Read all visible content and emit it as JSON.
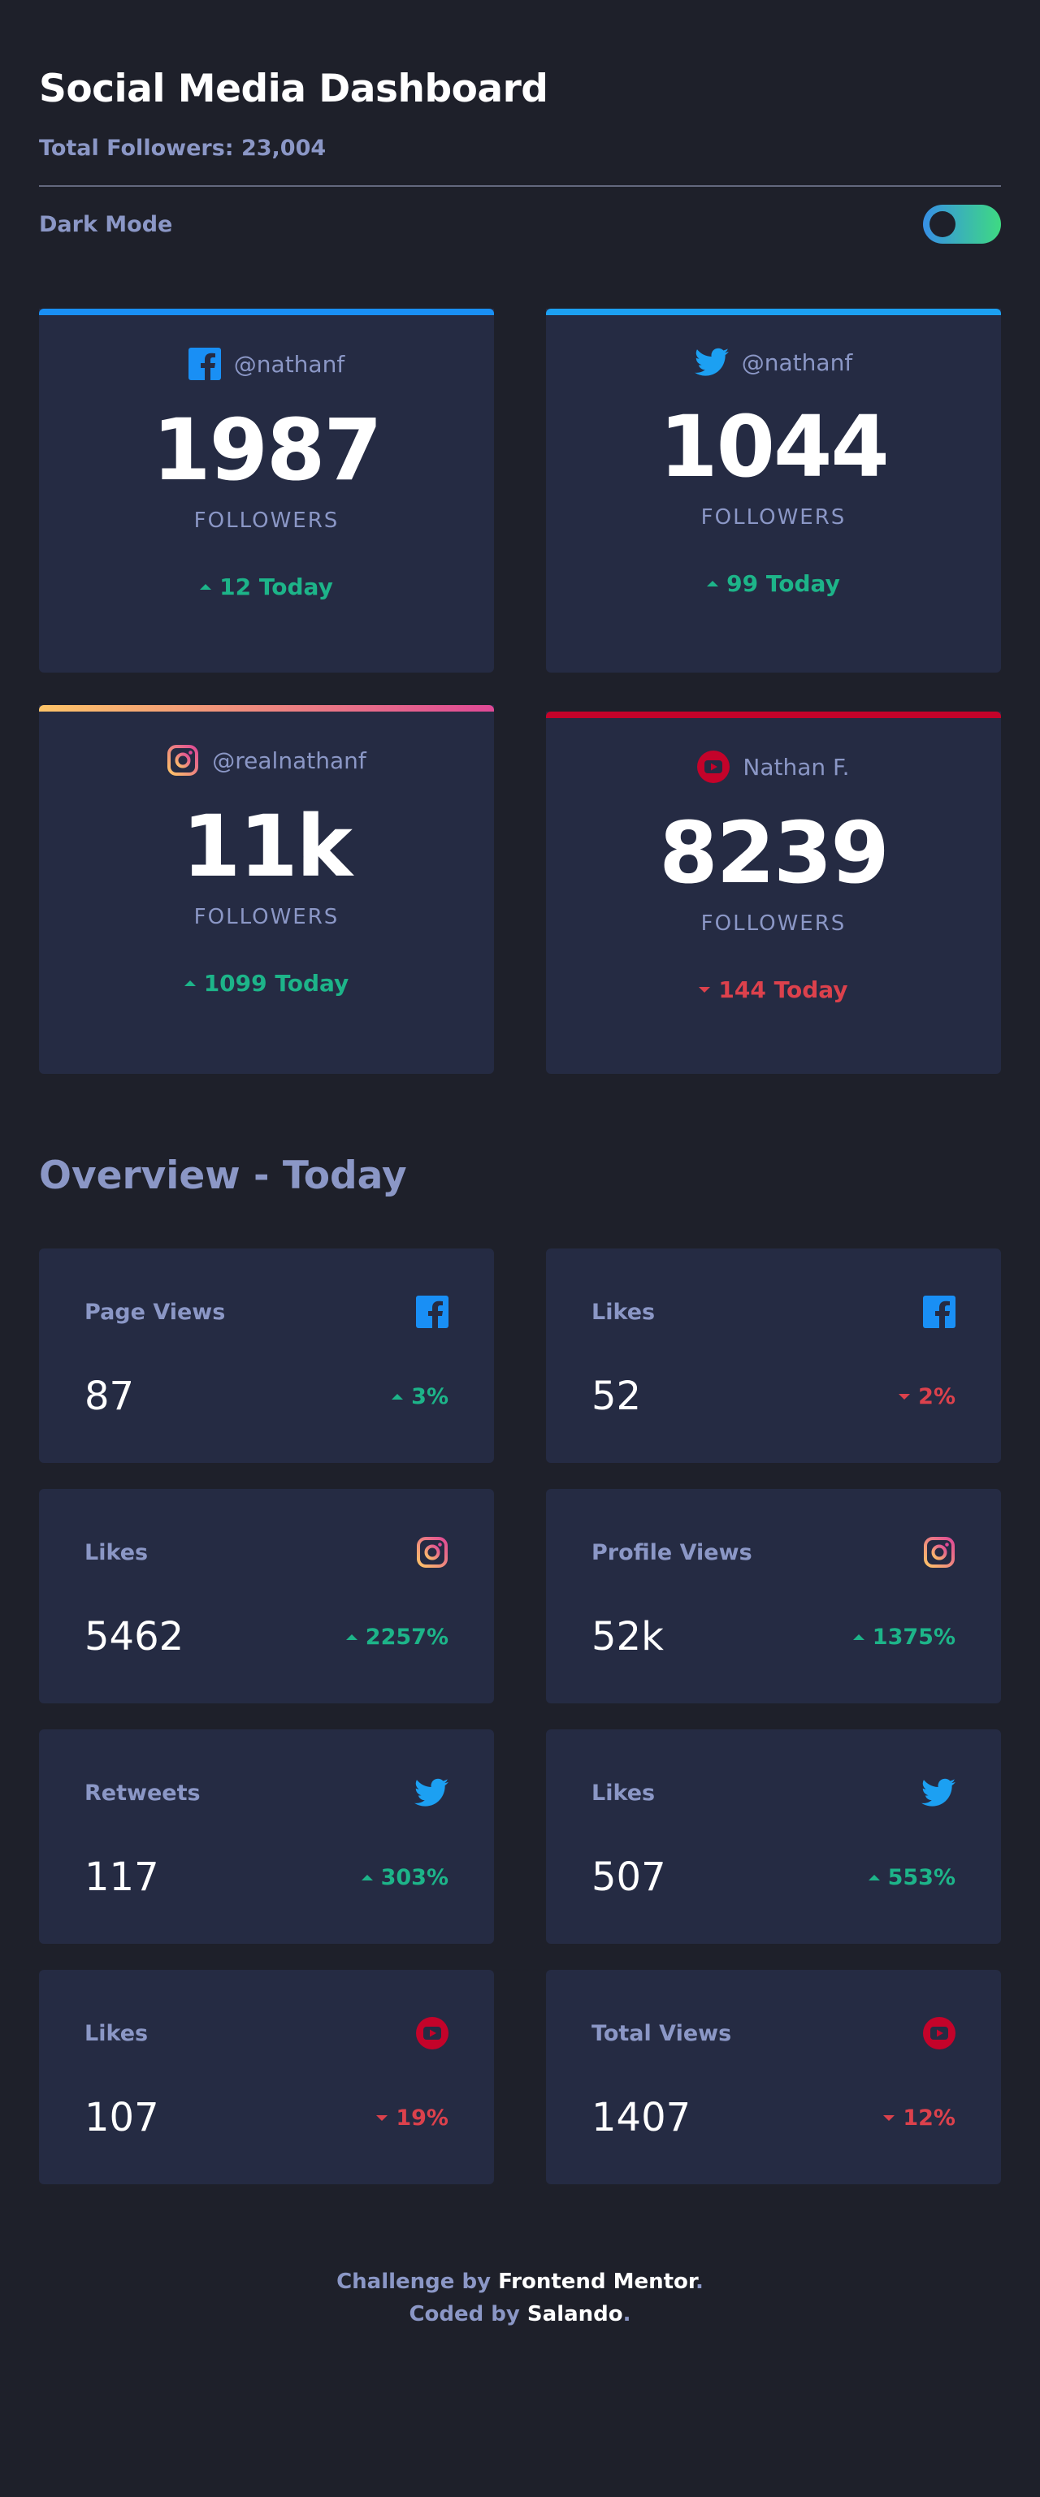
{
  "header": {
    "title": "Social Media Dashboard",
    "total_followers": "Total Followers: 23,004",
    "dark_mode_label": "Dark Mode"
  },
  "colors": {
    "background": "#1e202a",
    "card": "#252b43",
    "text_muted": "#8b97c6",
    "up": "#1db489",
    "down": "#dc414c",
    "facebook": "#198ff5",
    "twitter": "#1ca0f2",
    "instagram_start": "#fdc468",
    "instagram_end": "#df4996",
    "youtube": "#c4032a"
  },
  "followers": [
    {
      "platform": "facebook",
      "icon": "facebook-icon",
      "handle": "@nathanf",
      "count": "1987",
      "label": "FOLLOWERS",
      "today": "12 Today",
      "trend": "up"
    },
    {
      "platform": "twitter",
      "icon": "twitter-icon",
      "handle": "@nathanf",
      "count": "1044",
      "label": "FOLLOWERS",
      "today": "99 Today",
      "trend": "up"
    },
    {
      "platform": "instagram",
      "icon": "instagram-icon",
      "handle": "@realnathanf",
      "count": "11k",
      "label": "FOLLOWERS",
      "today": "1099 Today",
      "trend": "up"
    },
    {
      "platform": "youtube",
      "icon": "youtube-icon",
      "handle": "Nathan F.",
      "count": "8239",
      "label": "FOLLOWERS",
      "today": "144 Today",
      "trend": "down"
    }
  ],
  "overview": {
    "title": "Overview - Today",
    "items": [
      {
        "metric": "Page Views",
        "icon": "facebook-icon",
        "value": "87",
        "change": "3%",
        "trend": "up"
      },
      {
        "metric": "Likes",
        "icon": "facebook-icon",
        "value": "52",
        "change": "2%",
        "trend": "down"
      },
      {
        "metric": "Likes",
        "icon": "instagram-icon",
        "value": "5462",
        "change": "2257%",
        "trend": "up"
      },
      {
        "metric": "Profile Views",
        "icon": "instagram-icon",
        "value": "52k",
        "change": "1375%",
        "trend": "up"
      },
      {
        "metric": "Retweets",
        "icon": "twitter-icon",
        "value": "117",
        "change": "303%",
        "trend": "up"
      },
      {
        "metric": "Likes",
        "icon": "twitter-icon",
        "value": "507",
        "change": "553%",
        "trend": "up"
      },
      {
        "metric": "Likes",
        "icon": "youtube-icon",
        "value": "107",
        "change": "19%",
        "trend": "down"
      },
      {
        "metric": "Total Views",
        "icon": "youtube-icon",
        "value": "1407",
        "change": "12%",
        "trend": "down"
      }
    ]
  },
  "footer": {
    "challenge_prefix": "Challenge by ",
    "challenge_link": "Frontend Mentor",
    "coded_prefix": "Coded by ",
    "coded_link": "Salando",
    "period": "."
  }
}
